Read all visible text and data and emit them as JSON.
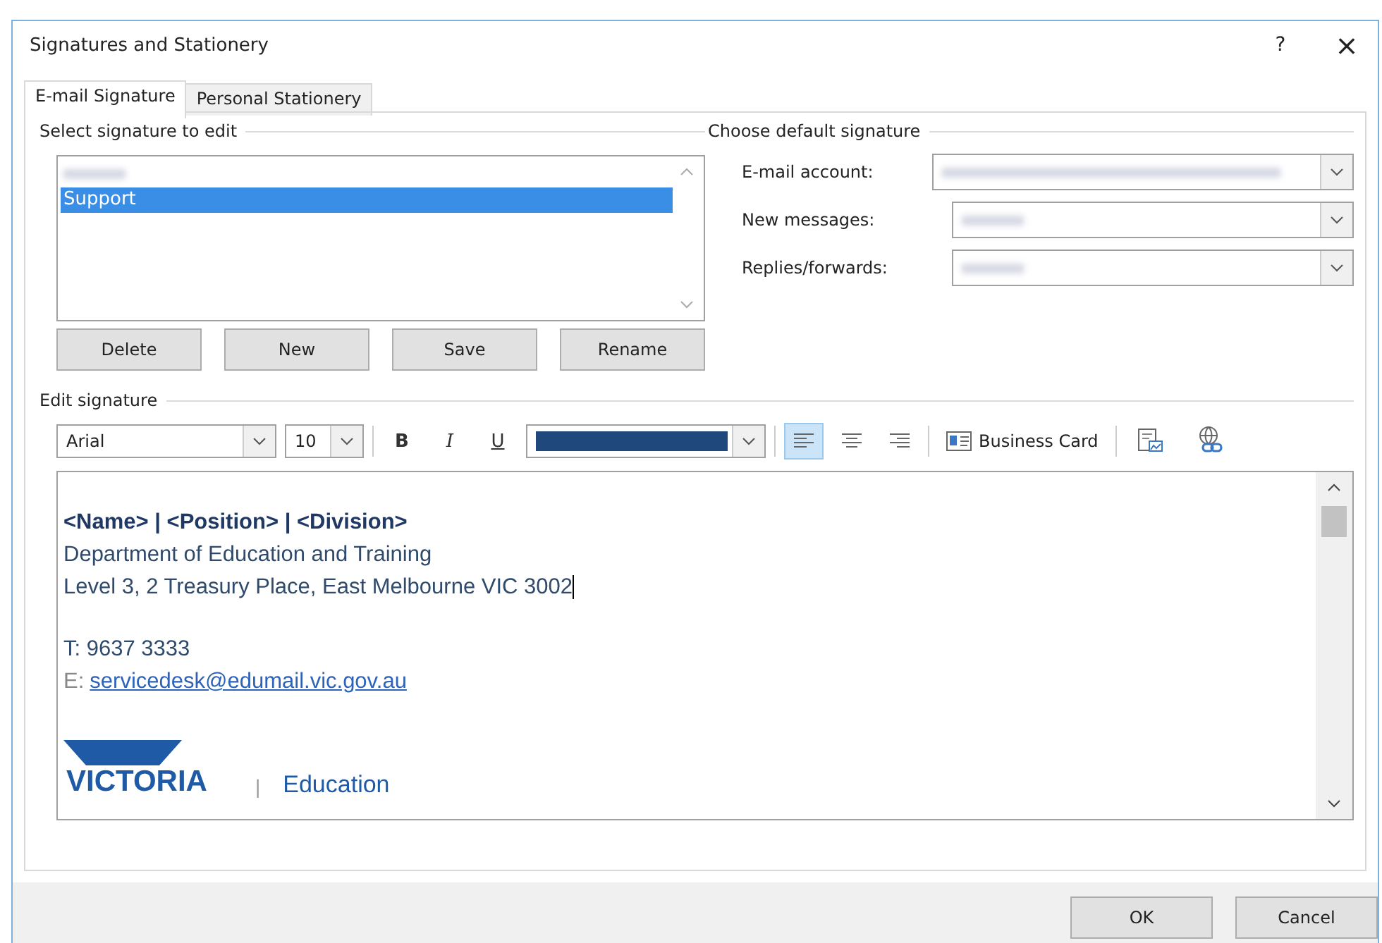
{
  "window": {
    "title": "Signatures and Stationery",
    "help": "?",
    "close": "×"
  },
  "tabs": [
    {
      "label": "E-mail Signature",
      "selected": true
    },
    {
      "label": "Personal Stationery",
      "selected": false
    }
  ],
  "select_group": {
    "title": "Select signature to edit",
    "items": [
      {
        "blurred": true,
        "selected": false
      },
      {
        "blurred": false,
        "label": "Support",
        "selected": true
      }
    ],
    "buttons": [
      "Delete",
      "New",
      "Save",
      "Rename"
    ]
  },
  "default_group": {
    "title": "Choose default signature",
    "fields": [
      {
        "label": "E-mail account:",
        "blurred": true
      },
      {
        "label": "New messages:",
        "blurred": true
      },
      {
        "label": "Replies/forwards:",
        "blurred": true
      }
    ]
  },
  "edit_group": {
    "title": "Edit signature",
    "toolbar": {
      "font": "Arial",
      "size": "10",
      "bold": "B",
      "italic": "I",
      "underline": "U",
      "align": [
        {
          "kind": "left",
          "selected": true
        },
        {
          "kind": "center",
          "selected": false
        },
        {
          "kind": "right",
          "selected": false
        }
      ],
      "business_card": "Business Card"
    },
    "lines": [
      {
        "kind": "bold",
        "text": "<Name> | <Position> | <Division>"
      },
      {
        "kind": "plain",
        "text": "Department of Education and Training"
      },
      {
        "kind": "plain",
        "text": "Level 3, 2 Treasury Place, East Melbourne VIC 3002",
        "caret": true
      },
      {
        "kind": "spacer"
      },
      {
        "kind": "plain",
        "text": "T: 9637 3333"
      },
      {
        "kind": "contact",
        "label": "E:",
        "link": "servicedesk@edumail.vic.gov.au"
      }
    ],
    "logo": {
      "name": "VICTORIA",
      "divider": "|",
      "unit": "Education"
    }
  },
  "buttons": [
    "OK",
    "Cancel"
  ]
}
